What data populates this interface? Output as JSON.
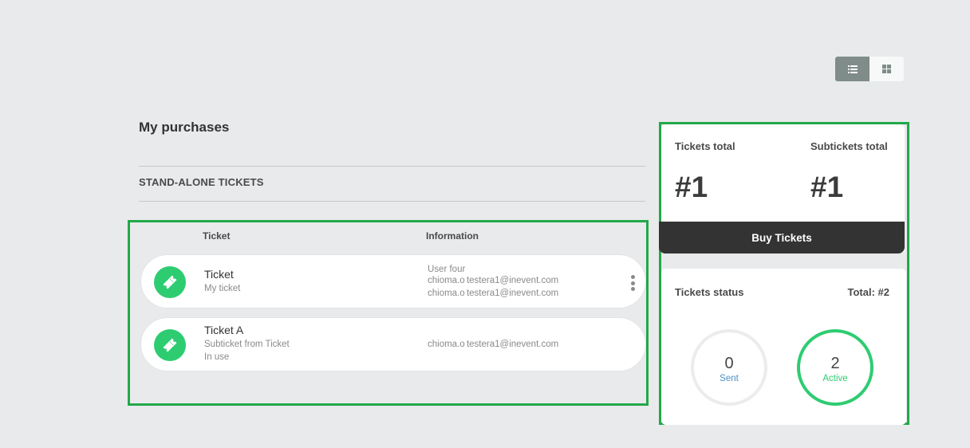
{
  "view_toggle": {
    "list_icon": "list-icon",
    "grid_icon": "grid-icon",
    "active": "list"
  },
  "page_title": "My purchases",
  "section_title": "STAND-ALONE TICKETS",
  "table": {
    "columns": [
      "Ticket",
      "Information"
    ],
    "rows": [
      {
        "icon": "ticket-icon",
        "name": "Ticket",
        "subtitle": "My ticket",
        "info": [
          "User four",
          "chioma.o testera1@inevent.com",
          "chioma.o testera1@inevent.com"
        ]
      },
      {
        "icon": "ticket-icon",
        "name": "Ticket A",
        "subtitle": "Subticket from Ticket",
        "status": "In use",
        "info": [
          "chioma.o testera1@inevent.com"
        ]
      }
    ]
  },
  "summary": {
    "tickets_total_label": "Tickets total",
    "tickets_total_value": "#1",
    "subtickets_total_label": "Subtickets total",
    "subtickets_total_value": "#1",
    "buy_button": "Buy Tickets"
  },
  "status": {
    "label": "Tickets status",
    "total": "Total: #2",
    "sent_count": "0",
    "sent_label": "Sent",
    "active_count": "2",
    "active_label": "Active"
  },
  "colors": {
    "accent_green": "#2ecc71",
    "dark_button": "#333333",
    "sent_blue": "#4a90c4"
  }
}
